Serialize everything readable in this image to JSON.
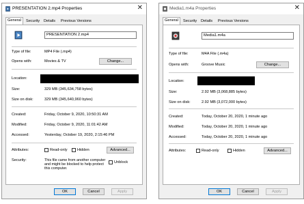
{
  "left": {
    "title": "PRESENTATION 2.mp4 Properties",
    "tabs": [
      "General",
      "Security",
      "Details",
      "Previous Versions"
    ],
    "file_name": "PRESENTATION 2.mp4",
    "type_label": "Type of file:",
    "type_value": "MP4 File (.mp4)",
    "opens_label": "Opens with:",
    "opens_value": "Movies & TV",
    "change_label": "Change...",
    "location_label": "Location:",
    "size_label": "Size:",
    "size_value": "329 MB (345,634,758 bytes)",
    "disk_label": "Size on disk:",
    "disk_value": "329 MB (345,640,960 bytes)",
    "created_label": "Created:",
    "created_value": "Friday, October 9, 2020, 10:50:31 AM",
    "modified_label": "Modified:",
    "modified_value": "Friday, October 9, 2020, 11:01:42 AM",
    "accessed_label": "Accessed:",
    "accessed_value": "Yesterday, October 19, 2020, 2:15:46 PM",
    "attributes_label": "Attributes:",
    "readonly_label": "Read-only",
    "hidden_label": "Hidden",
    "advanced_label": "Advanced...",
    "security_label": "Security:",
    "security_text": "This file came from another computer and might be blocked to help protect this computer.",
    "unblock_label": "Unblock",
    "ok_label": "OK",
    "cancel_label": "Cancel",
    "apply_label": "Apply"
  },
  "right": {
    "title": "Media1.m4a Properties",
    "tabs": [
      "General",
      "Security",
      "Details",
      "Previous Versions"
    ],
    "file_name": "Media1.m4a",
    "type_label": "Type of file:",
    "type_value": "M4A File (.m4a)",
    "opens_label": "Opens with:",
    "opens_value": "Groove Music",
    "change_label": "Change...",
    "location_label": "Location:",
    "size_label": "Size:",
    "size_value": "2.92 MB (3,068,885 bytes)",
    "disk_label": "Size on disk:",
    "disk_value": "2.92 MB (3,072,000 bytes)",
    "created_label": "Created:",
    "created_value": "Today, October 20, 2020, 1 minute ago",
    "modified_label": "Modified:",
    "modified_value": "Today, October 20, 2020, 1 minute ago",
    "accessed_label": "Accessed:",
    "accessed_value": "Today, October 20, 2020, 1 minute ago",
    "attributes_label": "Attributes:",
    "readonly_label": "Read-only",
    "hidden_label": "Hidden",
    "advanced_label": "Advanced...",
    "ok_label": "OK",
    "cancel_label": "Cancel",
    "apply_label": "Apply"
  },
  "icons": {
    "left_title_icon": "video-file-icon",
    "right_title_icon": "audio-file-icon",
    "close": "close-icon"
  },
  "colors": {
    "dialog_bg": "#f0f0f0",
    "panel_bg": "#ffffff",
    "redaction": "#000000",
    "primary_border": "#0078d7"
  }
}
